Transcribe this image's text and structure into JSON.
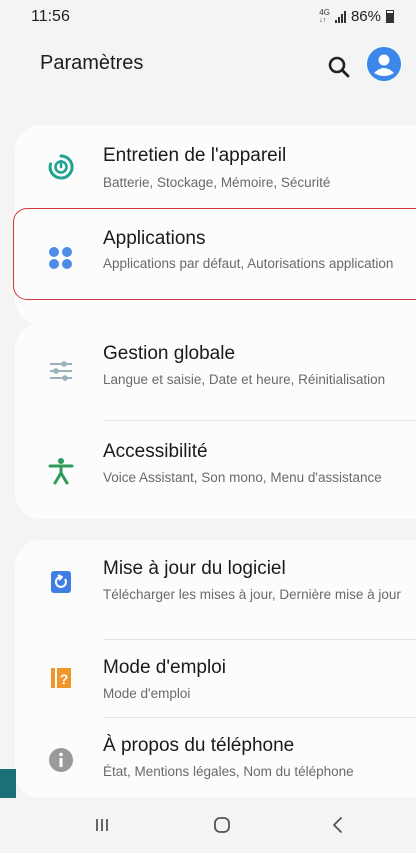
{
  "status_bar": {
    "time": "11:56",
    "network": "4G",
    "battery": "86%"
  },
  "header": {
    "title": "Paramètres",
    "search_icon": "search-icon",
    "profile_icon": "account-icon"
  },
  "items": [
    {
      "label": "Entretien de l'appareil",
      "sub": "Batterie, Stockage, Mémoire, Sécurité",
      "icon": "device-care-icon",
      "color": "#1fa38f"
    },
    {
      "label": "Applications",
      "sub": "Applications par défaut, Autorisations application",
      "icon": "apps-icon",
      "color": "#4d8de8"
    },
    {
      "label": "Gestion globale",
      "sub": "Langue et saisie, Date et heure, Réinitialisation",
      "icon": "sliders-icon",
      "color": "#9bb0b8"
    },
    {
      "label": "Accessibilité",
      "sub": "Voice Assistant, Son mono, Menu d'assistance",
      "icon": "accessibility-icon",
      "color": "#2c9c5a"
    },
    {
      "label": "Mise à jour du logiciel",
      "sub": "Télécharger les mises à jour, Dernière mise à jour",
      "icon": "software-update-icon",
      "color": "#3f7fe4"
    },
    {
      "label": "Mode d'emploi",
      "sub": "Mode d'emploi",
      "icon": "user-manual-icon",
      "color": "#f0972b"
    },
    {
      "label": "À propos du téléphone",
      "sub": "État, Mentions légales, Nom du téléphone",
      "icon": "info-icon",
      "color": "#9a9a9a"
    }
  ],
  "nav": {
    "recent_icon": "recent-apps-icon",
    "home_icon": "home-icon",
    "back_icon": "back-icon"
  }
}
